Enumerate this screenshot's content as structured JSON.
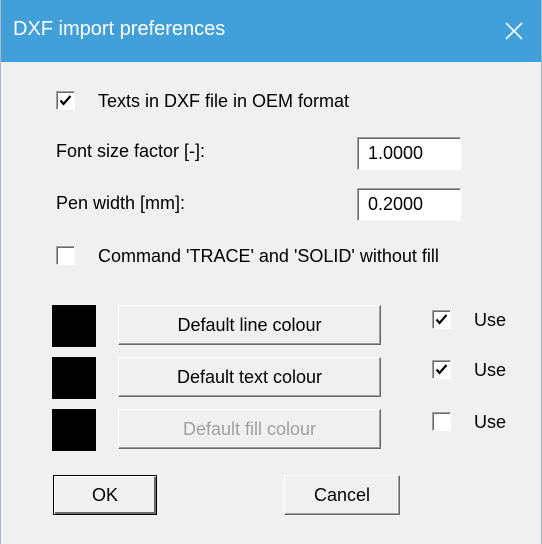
{
  "window": {
    "title": "DXF import preferences",
    "close_icon": "close-icon",
    "titlebar_color": "#419fd9"
  },
  "oem_format": {
    "label": "Texts in DXF file in OEM format",
    "checked": true
  },
  "font_size_factor": {
    "label": "Font size factor [-]:",
    "value": "1.0000"
  },
  "pen_width": {
    "label": "Pen width [mm]:",
    "value": "0.2000"
  },
  "trace_solid": {
    "label": "Command 'TRACE' and 'SOLID' without fill",
    "checked": false
  },
  "colours": [
    {
      "button_label": "Default line colour",
      "swatch_color": "#000000",
      "use_label": "Use",
      "use_checked": true,
      "enabled": true
    },
    {
      "button_label": "Default text colour",
      "swatch_color": "#000000",
      "use_label": "Use",
      "use_checked": true,
      "enabled": true
    },
    {
      "button_label": "Default fill colour",
      "swatch_color": "#000000",
      "use_label": "Use",
      "use_checked": false,
      "enabled": false
    }
  ],
  "buttons": {
    "ok_label": "OK",
    "cancel_label": "Cancel"
  }
}
